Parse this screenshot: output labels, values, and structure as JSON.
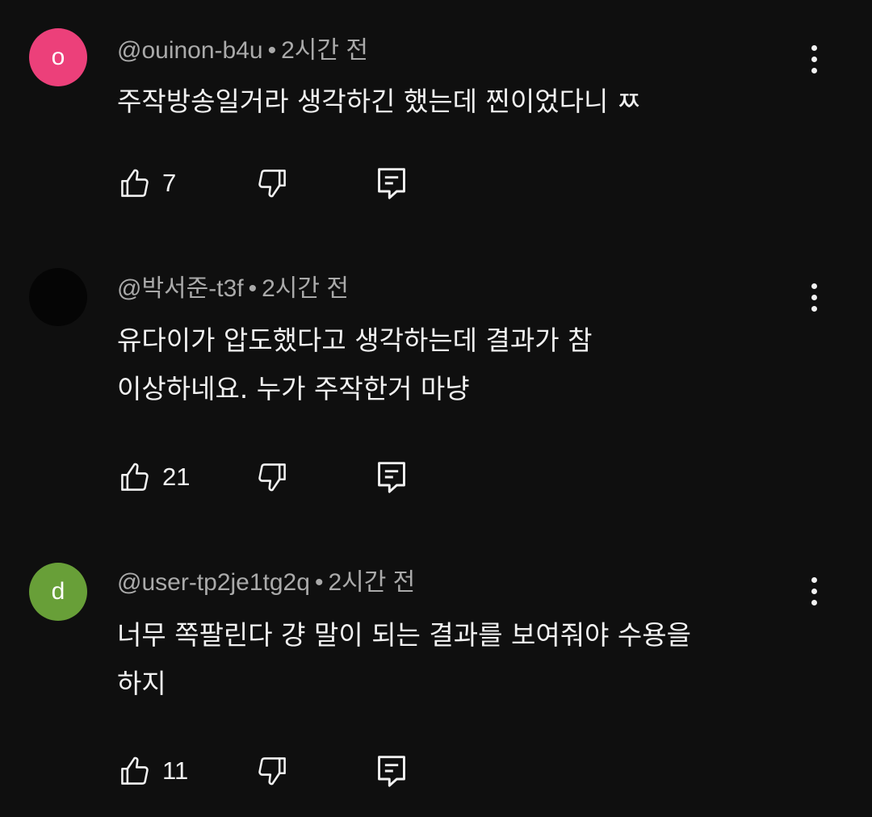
{
  "comments": [
    {
      "avatar_letter": "o",
      "avatar_color": "#ec407a",
      "author": "@ouinon-b4u",
      "separator": "•",
      "time": "2시간 전",
      "text": "주작방송일거라 생각하긴 했는데 찐이었다니 ㅉ",
      "likes": "7"
    },
    {
      "avatar_letter": "",
      "avatar_color": "#050505",
      "author": "@박서준-t3f",
      "separator": "•",
      "time": "2시간 전",
      "text": "유다이가 압도했다고 생각하는데 결과가 참\n이상하네요. 누가 주작한거 마냥",
      "likes": "21"
    },
    {
      "avatar_letter": "d",
      "avatar_color": "#689f38",
      "author": "@user-tp2je1tg2q",
      "separator": "•",
      "time": "2시간 전",
      "text": "너무 쪽팔린다 걍 말이 되는 결과를 보여줘야 수용을\n하지",
      "likes": "11"
    }
  ],
  "icons": {
    "like": "thumbs-up-icon",
    "dislike": "thumbs-down-icon",
    "reply": "reply-comment-icon",
    "menu": "more-vertical-icon"
  }
}
